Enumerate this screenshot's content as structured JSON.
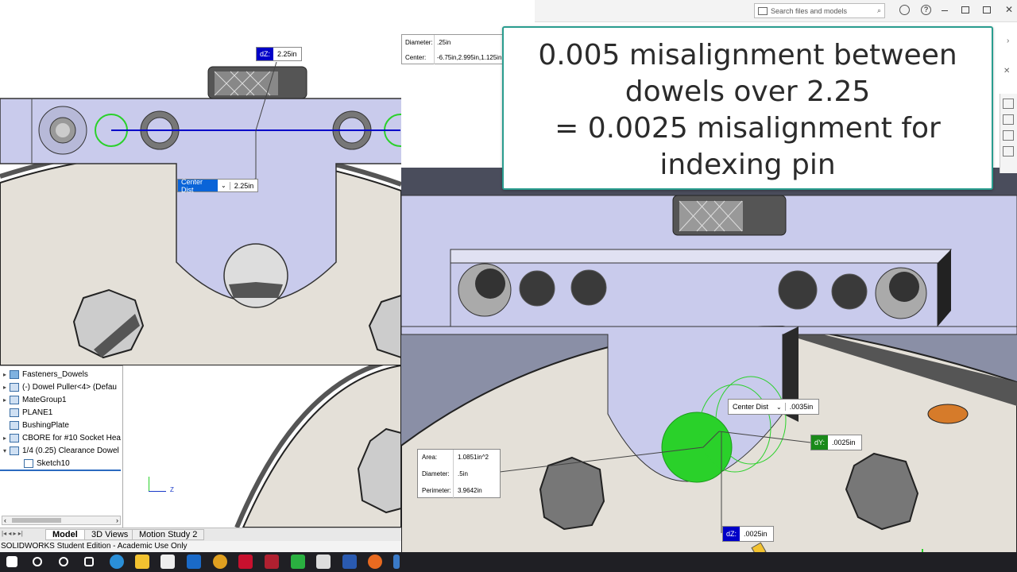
{
  "annotation": {
    "line1": "0.005 misalignment between",
    "line2": "dowels over 2.25",
    "line3": "= 0.0025 misalignment for",
    "line4": "indexing pin"
  },
  "search": {
    "placeholder": "Search files and models"
  },
  "left_view": {
    "dz_key": "dZ:",
    "dz_value": "2.25in",
    "center_dist_label": "Center Dist",
    "center_dist_value": "2.25in"
  },
  "info_box": {
    "diameter_label": "Diameter:",
    "diameter_value": ".25in",
    "center_label": "Center:",
    "center_value": "-6.75in,2.995in,1.125in"
  },
  "right_view": {
    "center_dist_label": "Center Dist",
    "center_dist_value": ".0035in",
    "dy_key": "dY:",
    "dy_value": ".0025in",
    "dz_key": "dZ:",
    "dz_value": ".0025in",
    "area_label": "Area:",
    "area_value": "1.0851in^2",
    "diameter_label": "Diameter:",
    "diameter_value": ".5in",
    "perimeter_label": "Perimeter:",
    "perimeter_value": "3.9642in"
  },
  "tree": {
    "items": [
      {
        "label": "Fasteners_Dowels",
        "expander": "▸"
      },
      {
        "label": "(-) Dowel Puller<4> (Defau",
        "expander": "▸"
      },
      {
        "label": "MateGroup1",
        "expander": "▸"
      },
      {
        "label": "PLANE1",
        "expander": ""
      },
      {
        "label": "BushingPlate",
        "expander": ""
      },
      {
        "label": "CBORE for #10 Socket Hea",
        "expander": "▸"
      },
      {
        "label": "1/4 (0.25) Clearance Dowel",
        "expander": "▾"
      },
      {
        "label": "Sketch10",
        "expander": ""
      }
    ]
  },
  "triad": {
    "z_label": "Z"
  },
  "tabs": {
    "model": "Model",
    "views3d": "3D Views",
    "motion": "Motion Study 2"
  },
  "status": {
    "text": "SOLIDWORKS Student Edition - Academic Use Only"
  },
  "colors": {
    "accent": "#2a9d8f",
    "plate": "#c9cbec",
    "dim_blue": "#0000c8",
    "select_green": "#2ad12a"
  }
}
